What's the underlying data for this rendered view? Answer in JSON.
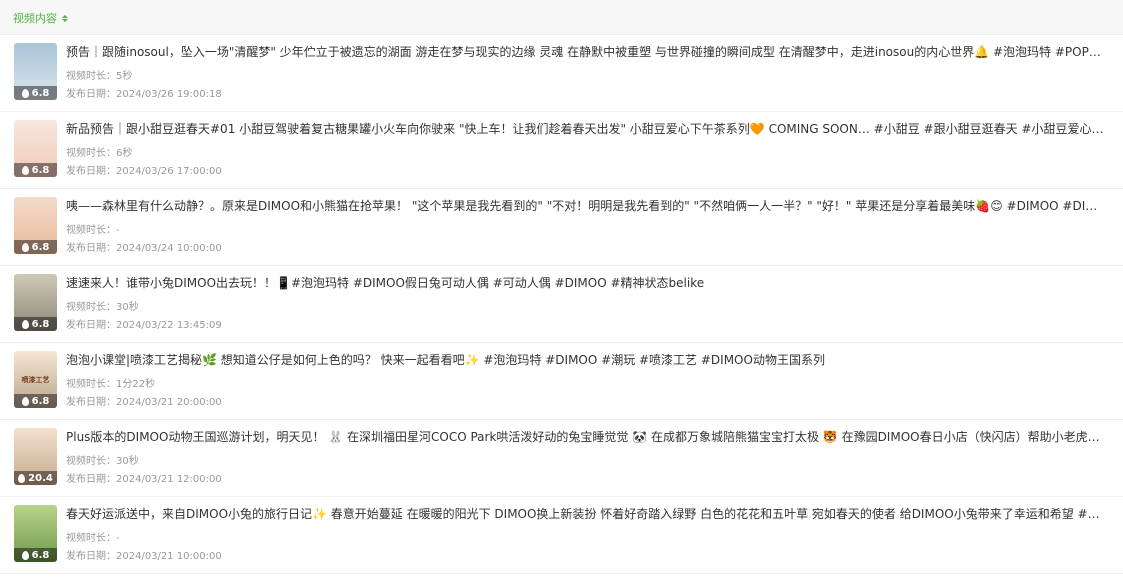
{
  "header": {
    "label": "视频内容"
  },
  "duration_label": "视频时长：",
  "date_label": "发布日期：",
  "items": [
    {
      "title": "预告｜跟随inosoul，坠入一场\"清醒梦\" 少年伫立于被遗忘的湖面 游走在梦与现实的边缘 灵魂 在静默中被重塑 与世界碰撞的瞬间成型 在清醒梦中，走进inosou的内心世界🔔 #泡泡玛特 #POPMART",
      "duration": "5秒",
      "date": "2024/03/26 19:00:18",
      "score": "6.8",
      "thumb_top": "#a9c4d8",
      "thumb_bottom": "#dbe6ee"
    },
    {
      "title": "新品预告｜跟小甜豆逛春天#01 小甜豆驾驶着复古糖果罐小火车向你驶来 \"快上车！让我们趁着春天出发\" 小甜豆爱心下午茶系列🧡 COMING SOON… #小甜豆 #跟小甜豆逛春天 #小甜豆爱心下午茶",
      "duration": "6秒",
      "date": "2024/03/26 17:00:00",
      "score": "6.8",
      "thumb_top": "#f6e7de",
      "thumb_bottom": "#f2c9b8"
    },
    {
      "title": "咦——森林里有什么动静？。原来是DIMOO和小熊猫在抢苹果！ \"这个苹果是我先看到的\" \"不对！明明是我先看到的\" \"不然咱俩一人一半？\" \"好！\" 苹果还是分享着最美味🍓😊 #DIMOO #DIMOO动物王国",
      "duration": "-",
      "date": "2024/03/24 10:00:00",
      "score": "6.8",
      "thumb_top": "#f3dac9",
      "thumb_bottom": "#e9b99a"
    },
    {
      "title": "速速来人！谁带小兔DIMOO出去玩！！📱#泡泡玛特 #DIMOO假日兔可动人偶 #可动人偶 #DIMOO #精神状态belike",
      "duration": "30秒",
      "date": "2024/03/22 13:45:09",
      "score": "6.8",
      "thumb_top": "#cfc9b8",
      "thumb_bottom": "#8d8778"
    },
    {
      "title": "泡泡小课堂|喷漆工艺揭秘🌿 想知道公仔是如何上色的吗？ 快来一起看看吧✨ #泡泡玛特 #DIMOO #潮玩 #喷漆工艺 #DIMOO动物王国系列",
      "duration": "1分22秒",
      "date": "2024/03/21 20:00:00",
      "score": "6.8",
      "thumb_top": "#f5e7d3",
      "thumb_bottom": "#b8a58d",
      "thumb_text": "喷漆工艺"
    },
    {
      "title": "Plus版本的DIMOO动物王国巡游计划，明天见！ 🐰 在深圳福田星河COCO Park哄活泼好动的兔宝睡觉觉 🐼 在成都万象城陪熊猫宝宝打太极 🐯 在豫园DIMOO春日小店（快闪店）帮助小老虎找到回家的路",
      "duration": "30秒",
      "date": "2024/03/21 12:00:00",
      "score": "20.4",
      "thumb_top": "#f1e1cf",
      "thumb_bottom": "#c9a98c"
    },
    {
      "title": "春天好运派送中，来自DIMOO小兔的旅行日记✨ 春意开始蔓延 在暖暖的阳光下 DIMOO换上新装扮 怀着好奇踏入绿野 白色的花花和五叶草 宛如春天的使者 给DIMOO小兔带来了幸运和希望 #DIMOO",
      "duration": "-",
      "date": "2024/03/21 10:00:00",
      "score": "6.8",
      "thumb_top": "#b9d38b",
      "thumb_bottom": "#6f9a4a"
    }
  ]
}
